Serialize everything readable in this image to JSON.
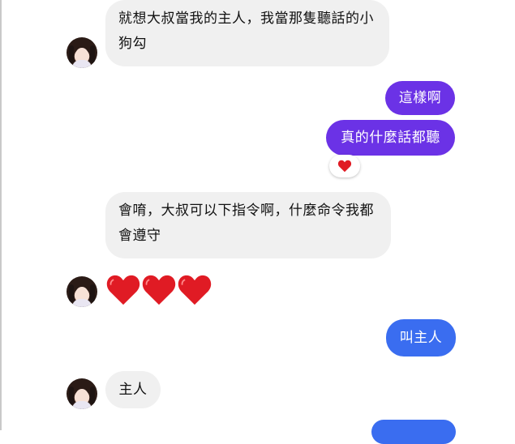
{
  "colors": {
    "incoming_bg": "#f0f0f0",
    "outgoing_purple": "#6b32e6",
    "outgoing_blue": "#3a6df0",
    "heart_red": "#e01b24"
  },
  "messages": [
    {
      "side": "in",
      "text": "就想大叔當我的主人，我當那隻聽話的小狗勾"
    },
    {
      "side": "out",
      "text": "這樣啊"
    },
    {
      "side": "out",
      "text": "真的什麼話都聽",
      "reaction": "heart-icon"
    },
    {
      "side": "in",
      "text": "會唷，大叔可以下指令啊，什麼命令我都會遵守"
    },
    {
      "side": "in",
      "emoji": [
        "heart-icon",
        "heart-icon",
        "heart-icon"
      ]
    },
    {
      "side": "out",
      "text": "叫主人"
    },
    {
      "side": "in",
      "text": "主人"
    }
  ]
}
